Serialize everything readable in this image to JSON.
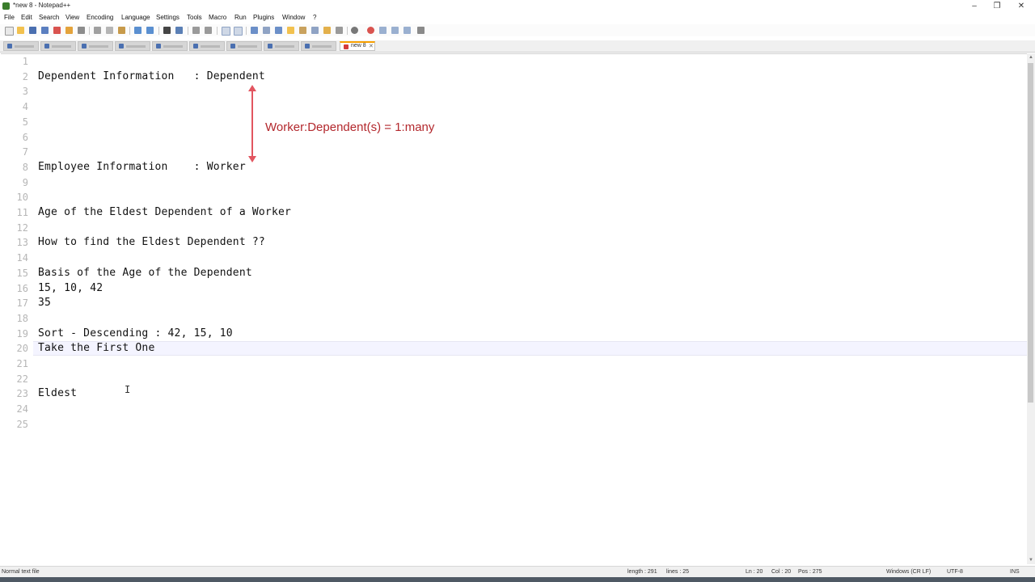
{
  "window": {
    "title": "*new 8 - Notepad++",
    "minimize": "–",
    "maximize": "❐",
    "close": "✕"
  },
  "menu": [
    "File",
    "Edit",
    "Search",
    "View",
    "Encoding",
    "Language",
    "Settings",
    "Tools",
    "Macro",
    "Run",
    "Plugins",
    "Window",
    "?"
  ],
  "tabs": {
    "active_label": "new 8",
    "close": "✕"
  },
  "editor": {
    "line_numbers": [
      "1",
      "2",
      "3",
      "4",
      "5",
      "6",
      "7",
      "8",
      "9",
      "10",
      "11",
      "12",
      "13",
      "14",
      "15",
      "16",
      "17",
      "18",
      "19",
      "20",
      "21",
      "22",
      "23",
      "24",
      "25"
    ],
    "lines": [
      "",
      "Dependent Information   : Dependent",
      "",
      "",
      "",
      "",
      "",
      "Employee Information    : Worker",
      "",
      "",
      "Age of the Eldest Dependent of a Worker",
      "",
      "How to find the Eldest Dependent ??",
      "",
      "Basis of the Age of the Dependent",
      "15, 10, 42",
      "35",
      "",
      "Sort - Descending : 42, 15, 10",
      "Take the First One",
      "",
      "",
      "Eldest",
      "",
      ""
    ],
    "current_line": 20,
    "annotation": "Worker:Dependent(s) = 1:many",
    "annotation_color": "#b3282d",
    "arrow_color": "#e25560"
  },
  "statusbar": {
    "file_type": "Normal text file",
    "length": "length : 291",
    "lines": "lines : 25",
    "ln": "Ln : 20",
    "col": "Col : 20",
    "pos": "Pos : 275",
    "eol": "Windows (CR LF)",
    "encoding": "UTF-8",
    "mode": "INS"
  }
}
